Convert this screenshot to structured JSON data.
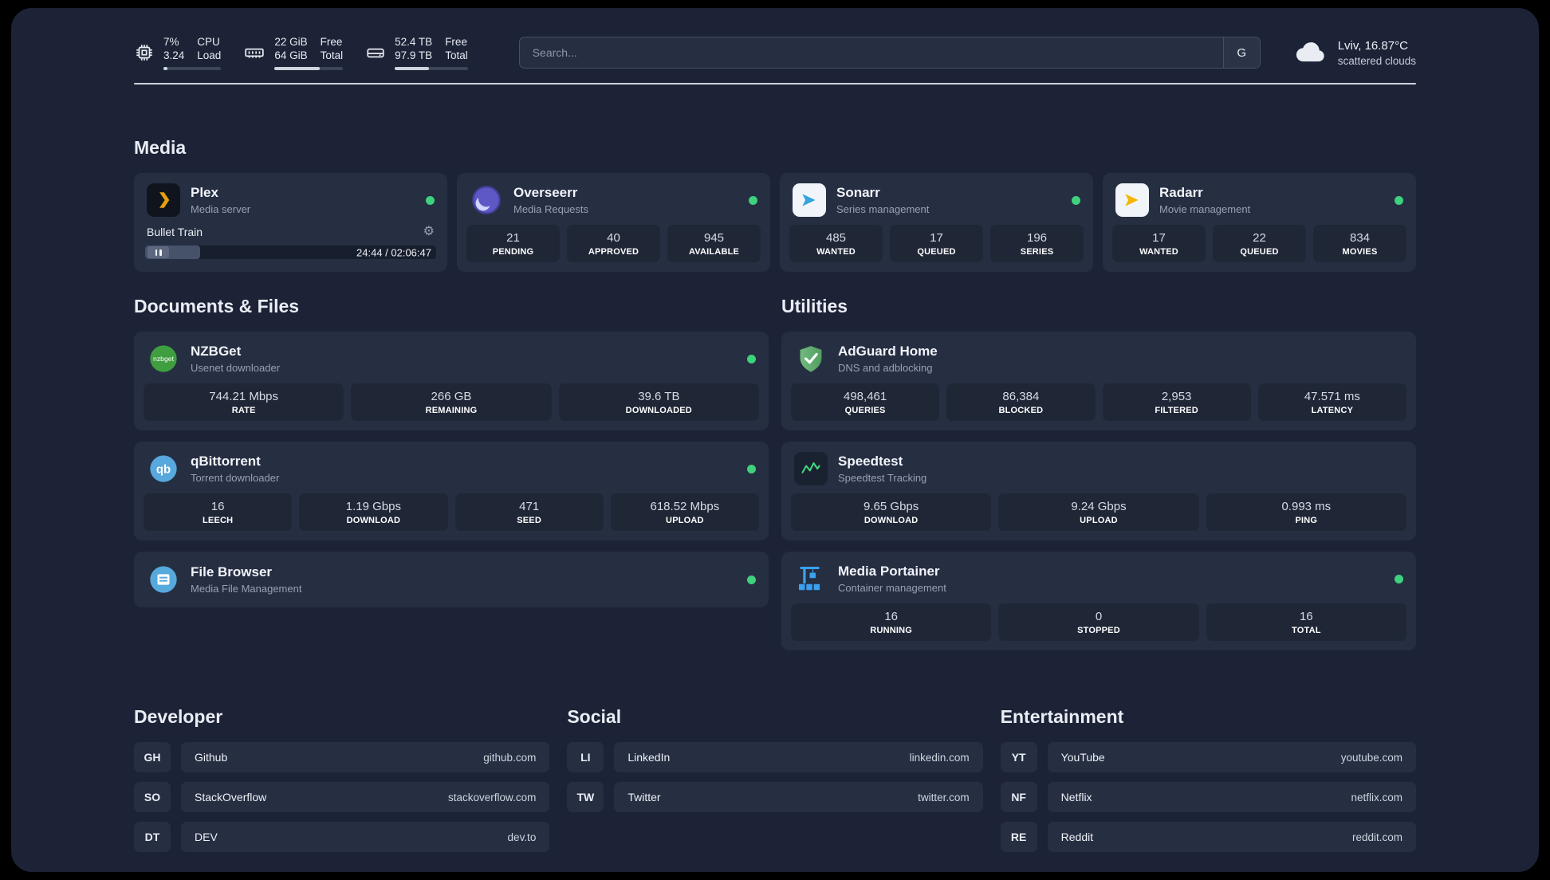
{
  "theme": {
    "status_online_color": "#3ed17e",
    "background": "#1c2336",
    "card": "#262e42"
  },
  "topbar": {
    "cpu": {
      "percent": "7%",
      "load": "3.24",
      "label_row1": "CPU",
      "label_row2": "Load",
      "meter_percent": 7
    },
    "memory": {
      "free": "22 GiB",
      "total": "64 GiB",
      "label_row1": "Free",
      "label_row2": "Total",
      "meter_percent": 66
    },
    "disk": {
      "free": "52.4 TB",
      "total": "97.9 TB",
      "label_row1": "Free",
      "label_row2": "Total",
      "meter_percent": 47
    },
    "search": {
      "placeholder": "Search...",
      "engine_letter": "G"
    },
    "weather": {
      "location": "Lviv, 16.87°C",
      "condition": "scattered clouds"
    }
  },
  "sections": {
    "media": {
      "title": "Media",
      "cards": [
        {
          "name": "Plex",
          "subtitle": "Media server",
          "icon": "plex-icon",
          "online": true,
          "player": {
            "title": "Bullet Train",
            "time": "24:44 / 02:06:47",
            "progress_percent": 19
          }
        },
        {
          "name": "Overseerr",
          "subtitle": "Media Requests",
          "icon": "overseerr-icon",
          "online": true,
          "stats": [
            {
              "value": "21",
              "label": "PENDING"
            },
            {
              "value": "40",
              "label": "APPROVED"
            },
            {
              "value": "945",
              "label": "AVAILABLE"
            }
          ]
        },
        {
          "name": "Sonarr",
          "subtitle": "Series management",
          "icon": "sonarr-icon",
          "online": true,
          "stats": [
            {
              "value": "485",
              "label": "WANTED"
            },
            {
              "value": "17",
              "label": "QUEUED"
            },
            {
              "value": "196",
              "label": "SERIES"
            }
          ]
        },
        {
          "name": "Radarr",
          "subtitle": "Movie management",
          "icon": "radarr-icon",
          "online": true,
          "stats": [
            {
              "value": "17",
              "label": "WANTED"
            },
            {
              "value": "22",
              "label": "QUEUED"
            },
            {
              "value": "834",
              "label": "MOVIES"
            }
          ]
        }
      ]
    },
    "documents": {
      "title": "Documents & Files",
      "cards": [
        {
          "name": "NZBGet",
          "subtitle": "Usenet downloader",
          "icon": "nzbget-icon",
          "online": true,
          "stats": [
            {
              "value": "744.21 Mbps",
              "label": "RATE"
            },
            {
              "value": "266 GB",
              "label": "REMAINING"
            },
            {
              "value": "39.6 TB",
              "label": "DOWNLOADED"
            }
          ]
        },
        {
          "name": "qBittorrent",
          "subtitle": "Torrent downloader",
          "icon": "qbittorrent-icon",
          "online": true,
          "stats": [
            {
              "value": "16",
              "label": "LEECH"
            },
            {
              "value": "1.19 Gbps",
              "label": "DOWNLOAD"
            },
            {
              "value": "471",
              "label": "SEED"
            },
            {
              "value": "618.52 Mbps",
              "label": "UPLOAD"
            }
          ]
        },
        {
          "name": "File Browser",
          "subtitle": "Media File Management",
          "icon": "filebrowser-icon",
          "online": true
        }
      ]
    },
    "utilities": {
      "title": "Utilities",
      "cards": [
        {
          "name": "AdGuard Home",
          "subtitle": "DNS and adblocking",
          "icon": "adguard-icon",
          "stats": [
            {
              "value": "498,461",
              "label": "QUERIES"
            },
            {
              "value": "86,384",
              "label": "BLOCKED"
            },
            {
              "value": "2,953",
              "label": "FILTERED"
            },
            {
              "value": "47.571 ms",
              "label": "LATENCY"
            }
          ]
        },
        {
          "name": "Speedtest",
          "subtitle": "Speedtest Tracking",
          "icon": "speedtest-icon",
          "stats": [
            {
              "value": "9.65 Gbps",
              "label": "DOWNLOAD"
            },
            {
              "value": "9.24 Gbps",
              "label": "UPLOAD"
            },
            {
              "value": "0.993 ms",
              "label": "PING"
            }
          ]
        },
        {
          "name": "Media Portainer",
          "subtitle": "Container management",
          "icon": "portainer-icon",
          "online": true,
          "stats": [
            {
              "value": "16",
              "label": "RUNNING"
            },
            {
              "value": "0",
              "label": "STOPPED"
            },
            {
              "value": "16",
              "label": "TOTAL"
            }
          ]
        }
      ]
    },
    "developer": {
      "title": "Developer",
      "links": [
        {
          "abbr": "GH",
          "name": "Github",
          "url": "github.com"
        },
        {
          "abbr": "SO",
          "name": "StackOverflow",
          "url": "stackoverflow.com"
        },
        {
          "abbr": "DT",
          "name": "DEV",
          "url": "dev.to"
        }
      ]
    },
    "social": {
      "title": "Social",
      "links": [
        {
          "abbr": "LI",
          "name": "LinkedIn",
          "url": "linkedin.com"
        },
        {
          "abbr": "TW",
          "name": "Twitter",
          "url": "twitter.com"
        }
      ]
    },
    "entertainment": {
      "title": "Entertainment",
      "links": [
        {
          "abbr": "YT",
          "name": "YouTube",
          "url": "youtube.com"
        },
        {
          "abbr": "NF",
          "name": "Netflix",
          "url": "netflix.com"
        },
        {
          "abbr": "RE",
          "name": "Reddit",
          "url": "reddit.com"
        }
      ]
    }
  }
}
